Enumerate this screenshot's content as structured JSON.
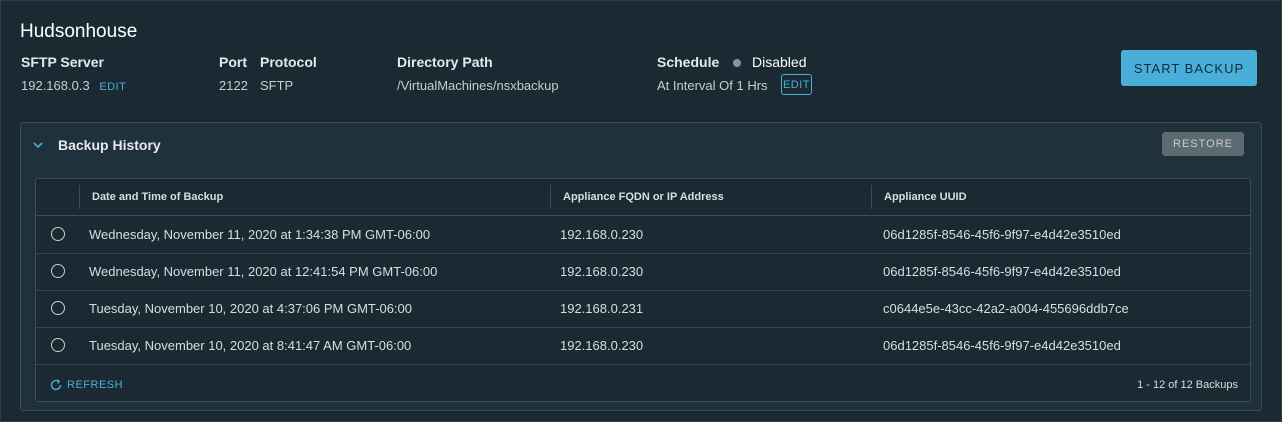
{
  "page": {
    "title": "Hudsonhouse"
  },
  "config": {
    "sftp_server": {
      "label": "SFTP Server",
      "value": "192.168.0.3",
      "edit": "EDIT"
    },
    "port": {
      "label": "Port",
      "value": "2122"
    },
    "protocol": {
      "label": "Protocol",
      "value": "SFTP"
    },
    "directory": {
      "label": "Directory Path",
      "value": "/VirtualMachines/nsxbackup"
    },
    "schedule": {
      "label": "Schedule",
      "status": "Disabled",
      "interval": "At Interval Of 1 Hrs",
      "edit": "EDIT"
    }
  },
  "actions": {
    "start_backup": "START BACKUP",
    "restore": "RESTORE",
    "refresh": "REFRESH"
  },
  "history": {
    "title": "Backup History",
    "columns": [
      "Date and Time of Backup",
      "Appliance FQDN or IP Address",
      "Appliance UUID"
    ],
    "rows": [
      [
        "Wednesday, November 11, 2020 at 1:34:38 PM GMT-06:00",
        "192.168.0.230",
        "06d1285f-8546-45f6-9f97-e4d42e3510ed"
      ],
      [
        "Wednesday, November 11, 2020 at 12:41:54 PM GMT-06:00",
        "192.168.0.230",
        "06d1285f-8546-45f6-9f97-e4d42e3510ed"
      ],
      [
        "Tuesday, November 10, 2020 at 4:37:06 PM GMT-06:00",
        "192.168.0.231",
        "c0644e5e-43cc-42a2-a004-455696ddb7ce"
      ],
      [
        "Tuesday, November 10, 2020 at 8:41:47 AM GMT-06:00",
        "192.168.0.230",
        "06d1285f-8546-45f6-9f97-e4d42e3510ed"
      ]
    ],
    "footer_count": "1 - 12 of 12 Backups"
  },
  "icons": {
    "chevron": "chevron-down-icon",
    "refresh": "refresh-icon",
    "status": "status-dot-icon"
  },
  "colors": {
    "accent": "#49afd9",
    "background": "#1b2a32",
    "disabled_dot": "#8a969d"
  }
}
